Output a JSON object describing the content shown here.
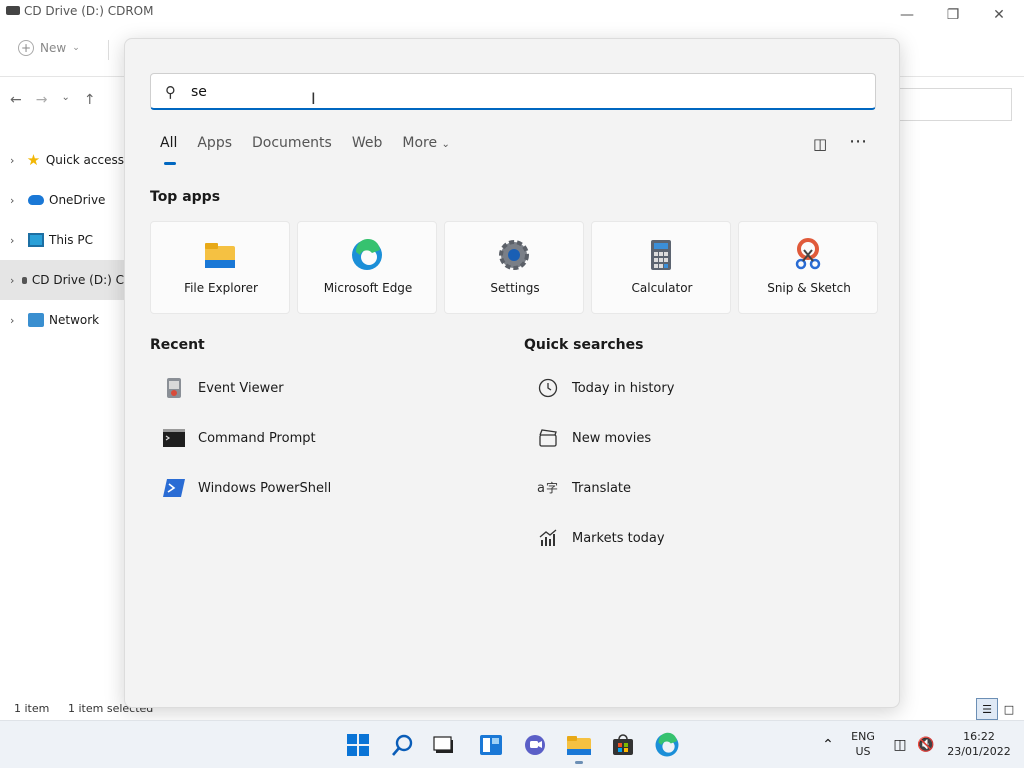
{
  "explorer": {
    "title": "CD Drive (D:) CDROM",
    "new_label": "New",
    "tree": [
      {
        "label": "Quick access",
        "icon": "star-icon"
      },
      {
        "label": "OneDrive",
        "icon": "cloud-icon"
      },
      {
        "label": "This PC",
        "icon": "pc-icon"
      },
      {
        "label": "CD Drive (D:) C",
        "icon": "drive-icon"
      },
      {
        "label": "Network",
        "icon": "network-icon"
      }
    ],
    "status_count": "1 item",
    "status_selected": "1 item selected"
  },
  "search": {
    "query": "se",
    "tabs": [
      "All",
      "Apps",
      "Documents",
      "Web",
      "More"
    ],
    "top_apps_title": "Top apps",
    "top_apps": [
      {
        "name": "File Explorer",
        "icon": "file-explorer-icon"
      },
      {
        "name": "Microsoft Edge",
        "icon": "edge-icon"
      },
      {
        "name": "Settings",
        "icon": "settings-gear-icon"
      },
      {
        "name": "Calculator",
        "icon": "calculator-icon"
      },
      {
        "name": "Snip & Sketch",
        "icon": "snip-sketch-icon"
      }
    ],
    "recent_title": "Recent",
    "recent": [
      {
        "name": "Event Viewer",
        "icon": "event-viewer-icon"
      },
      {
        "name": "Command Prompt",
        "icon": "command-prompt-icon"
      },
      {
        "name": "Windows PowerShell",
        "icon": "powershell-icon"
      }
    ],
    "quick_title": "Quick searches",
    "quick": [
      {
        "name": "Today in history",
        "icon": "clock-icon"
      },
      {
        "name": "New movies",
        "icon": "clapperboard-icon"
      },
      {
        "name": "Translate",
        "icon": "translate-icon"
      },
      {
        "name": "Markets today",
        "icon": "chart-icon"
      }
    ]
  },
  "taskbar": {
    "lang_top": "ENG",
    "lang_bottom": "US",
    "time": "16:22",
    "date": "23/01/2022"
  },
  "colors": {
    "accent": "#0067c0",
    "flyout_bg": "#f3f3f3"
  }
}
